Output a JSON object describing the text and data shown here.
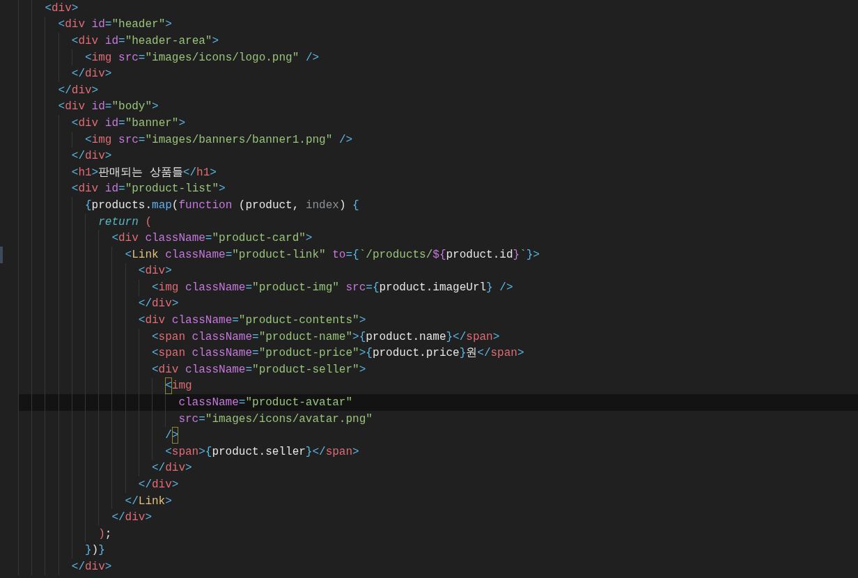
{
  "editor": {
    "lines": [
      {
        "current": false,
        "marked": false,
        "tokens": [
          {
            "kind": "punct",
            "text": "<"
          },
          {
            "kind": "tag",
            "text": "div"
          },
          {
            "kind": "punct",
            "text": ">"
          }
        ],
        "children": [
          {
            "current": false,
            "marked": false,
            "tokens": [
              {
                "kind": "punct",
                "text": "<"
              },
              {
                "kind": "tag",
                "text": "div"
              },
              {
                "kind": "attr",
                "text": " id"
              },
              {
                "kind": "punct",
                "text": "="
              },
              {
                "kind": "string",
                "text": "\"header\""
              },
              {
                "kind": "punct",
                "text": ">"
              }
            ],
            "children": [
              {
                "current": false,
                "marked": false,
                "tokens": [
                  {
                    "kind": "punct",
                    "text": "<"
                  },
                  {
                    "kind": "tag",
                    "text": "div"
                  },
                  {
                    "kind": "attr",
                    "text": " id"
                  },
                  {
                    "kind": "punct",
                    "text": "="
                  },
                  {
                    "kind": "string",
                    "text": "\"header-area\""
                  },
                  {
                    "kind": "punct",
                    "text": ">"
                  }
                ],
                "children": [
                  {
                    "current": false,
                    "marked": false,
                    "tokens": [
                      {
                        "kind": "punct",
                        "text": "<"
                      },
                      {
                        "kind": "tag",
                        "text": "img"
                      },
                      {
                        "kind": "attr",
                        "text": " src"
                      },
                      {
                        "kind": "punct",
                        "text": "="
                      },
                      {
                        "kind": "string",
                        "text": "\"images/icons/logo.png\""
                      },
                      {
                        "kind": "punct",
                        "text": " />"
                      }
                    ]
                  }
                ]
              },
              {
                "current": false,
                "marked": false,
                "tokens": [
                  {
                    "kind": "punct",
                    "text": "</"
                  },
                  {
                    "kind": "tag",
                    "text": "div"
                  },
                  {
                    "kind": "punct",
                    "text": ">"
                  }
                ]
              }
            ]
          },
          {
            "current": false,
            "marked": false,
            "tokens": [
              {
                "kind": "punct",
                "text": "</"
              },
              {
                "kind": "tag",
                "text": "div"
              },
              {
                "kind": "punct",
                "text": ">"
              }
            ]
          },
          {
            "current": false,
            "marked": false,
            "tokens": [
              {
                "kind": "punct",
                "text": "<"
              },
              {
                "kind": "tag",
                "text": "div"
              },
              {
                "kind": "attr",
                "text": " id"
              },
              {
                "kind": "punct",
                "text": "="
              },
              {
                "kind": "string",
                "text": "\"body\""
              },
              {
                "kind": "punct",
                "text": ">"
              }
            ],
            "children": [
              {
                "current": false,
                "marked": false,
                "tokens": [
                  {
                    "kind": "punct",
                    "text": "<"
                  },
                  {
                    "kind": "tag",
                    "text": "div"
                  },
                  {
                    "kind": "attr",
                    "text": " id"
                  },
                  {
                    "kind": "punct",
                    "text": "="
                  },
                  {
                    "kind": "string",
                    "text": "\"banner\""
                  },
                  {
                    "kind": "punct",
                    "text": ">"
                  }
                ],
                "children": [
                  {
                    "current": false,
                    "marked": false,
                    "tokens": [
                      {
                        "kind": "punct",
                        "text": "<"
                      },
                      {
                        "kind": "tag",
                        "text": "img"
                      },
                      {
                        "kind": "attr",
                        "text": " src"
                      },
                      {
                        "kind": "punct",
                        "text": "="
                      },
                      {
                        "kind": "string",
                        "text": "\"images/banners/banner1.png\""
                      },
                      {
                        "kind": "punct",
                        "text": " />"
                      }
                    ]
                  }
                ]
              },
              {
                "current": false,
                "marked": false,
                "tokens": [
                  {
                    "kind": "punct",
                    "text": "</"
                  },
                  {
                    "kind": "tag",
                    "text": "div"
                  },
                  {
                    "kind": "punct",
                    "text": ">"
                  }
                ]
              },
              {
                "current": false,
                "marked": false,
                "tokens": [
                  {
                    "kind": "punct",
                    "text": "<"
                  },
                  {
                    "kind": "tag",
                    "text": "h1"
                  },
                  {
                    "kind": "punct",
                    "text": ">"
                  },
                  {
                    "kind": "plain",
                    "text": "판매되는 상품들"
                  },
                  {
                    "kind": "punct",
                    "text": "</"
                  },
                  {
                    "kind": "tag",
                    "text": "h1"
                  },
                  {
                    "kind": "punct",
                    "text": ">"
                  }
                ]
              },
              {
                "current": false,
                "marked": false,
                "tokens": [
                  {
                    "kind": "punct",
                    "text": "<"
                  },
                  {
                    "kind": "tag",
                    "text": "div"
                  },
                  {
                    "kind": "attr",
                    "text": " id"
                  },
                  {
                    "kind": "punct",
                    "text": "="
                  },
                  {
                    "kind": "string",
                    "text": "\"product-list\""
                  },
                  {
                    "kind": "punct",
                    "text": ">"
                  }
                ],
                "children": [
                  {
                    "current": false,
                    "marked": false,
                    "tokens": [
                      {
                        "kind": "punct",
                        "text": "{"
                      },
                      {
                        "kind": "plain",
                        "text": "products."
                      },
                      {
                        "kind": "func",
                        "text": "map"
                      },
                      {
                        "kind": "plain",
                        "text": "("
                      },
                      {
                        "kind": "keyword",
                        "text": "function"
                      },
                      {
                        "kind": "plain",
                        "text": " (product, "
                      },
                      {
                        "kind": "param",
                        "text": "index"
                      },
                      {
                        "kind": "plain",
                        "text": ") "
                      },
                      {
                        "kind": "punct",
                        "text": "{"
                      }
                    ],
                    "children": [
                      {
                        "current": false,
                        "marked": false,
                        "tokens": [
                          {
                            "kind": "italic",
                            "text": "return"
                          },
                          {
                            "kind": "paren",
                            "text": " ("
                          }
                        ],
                        "children": [
                          {
                            "current": false,
                            "marked": false,
                            "tokens": [
                              {
                                "kind": "punct",
                                "text": "<"
                              },
                              {
                                "kind": "tag",
                                "text": "div"
                              },
                              {
                                "kind": "attr",
                                "text": " className"
                              },
                              {
                                "kind": "punct",
                                "text": "="
                              },
                              {
                                "kind": "string",
                                "text": "\"product-card\""
                              },
                              {
                                "kind": "punct",
                                "text": ">"
                              }
                            ],
                            "children": [
                              {
                                "current": false,
                                "marked": true,
                                "tokens": [
                                  {
                                    "kind": "punct",
                                    "text": "<"
                                  },
                                  {
                                    "kind": "component",
                                    "text": "Link"
                                  },
                                  {
                                    "kind": "attr",
                                    "text": " className"
                                  },
                                  {
                                    "kind": "punct",
                                    "text": "="
                                  },
                                  {
                                    "kind": "string",
                                    "text": "\"product-link\""
                                  },
                                  {
                                    "kind": "attr",
                                    "text": " to"
                                  },
                                  {
                                    "kind": "punct",
                                    "text": "={"
                                  },
                                  {
                                    "kind": "string",
                                    "text": "`/products/"
                                  },
                                  {
                                    "kind": "attr",
                                    "text": "${"
                                  },
                                  {
                                    "kind": "plain",
                                    "text": "product.id"
                                  },
                                  {
                                    "kind": "attr",
                                    "text": "}"
                                  },
                                  {
                                    "kind": "string",
                                    "text": "`"
                                  },
                                  {
                                    "kind": "punct",
                                    "text": "}>"
                                  }
                                ],
                                "children": [
                                  {
                                    "current": false,
                                    "marked": false,
                                    "tokens": [
                                      {
                                        "kind": "punct",
                                        "text": "<"
                                      },
                                      {
                                        "kind": "tag",
                                        "text": "div"
                                      },
                                      {
                                        "kind": "punct",
                                        "text": ">"
                                      }
                                    ],
                                    "children": [
                                      {
                                        "current": false,
                                        "marked": false,
                                        "tokens": [
                                          {
                                            "kind": "punct",
                                            "text": "<"
                                          },
                                          {
                                            "kind": "tag",
                                            "text": "img"
                                          },
                                          {
                                            "kind": "attr",
                                            "text": " className"
                                          },
                                          {
                                            "kind": "punct",
                                            "text": "="
                                          },
                                          {
                                            "kind": "string",
                                            "text": "\"product-img\""
                                          },
                                          {
                                            "kind": "attr",
                                            "text": " src"
                                          },
                                          {
                                            "kind": "punct",
                                            "text": "={"
                                          },
                                          {
                                            "kind": "plain",
                                            "text": "product.imageUrl"
                                          },
                                          {
                                            "kind": "punct",
                                            "text": "} />"
                                          }
                                        ]
                                      }
                                    ]
                                  },
                                  {
                                    "current": false,
                                    "marked": false,
                                    "tokens": [
                                      {
                                        "kind": "punct",
                                        "text": "</"
                                      },
                                      {
                                        "kind": "tag",
                                        "text": "div"
                                      },
                                      {
                                        "kind": "punct",
                                        "text": ">"
                                      }
                                    ]
                                  },
                                  {
                                    "current": false,
                                    "marked": false,
                                    "tokens": [
                                      {
                                        "kind": "punct",
                                        "text": "<"
                                      },
                                      {
                                        "kind": "tag",
                                        "text": "div"
                                      },
                                      {
                                        "kind": "attr",
                                        "text": " className"
                                      },
                                      {
                                        "kind": "punct",
                                        "text": "="
                                      },
                                      {
                                        "kind": "string",
                                        "text": "\"product-contents\""
                                      },
                                      {
                                        "kind": "punct",
                                        "text": ">"
                                      }
                                    ],
                                    "children": [
                                      {
                                        "current": false,
                                        "marked": false,
                                        "tokens": [
                                          {
                                            "kind": "punct",
                                            "text": "<"
                                          },
                                          {
                                            "kind": "tag",
                                            "text": "span"
                                          },
                                          {
                                            "kind": "attr",
                                            "text": " className"
                                          },
                                          {
                                            "kind": "punct",
                                            "text": "="
                                          },
                                          {
                                            "kind": "string",
                                            "text": "\"product-name\""
                                          },
                                          {
                                            "kind": "punct",
                                            "text": ">{"
                                          },
                                          {
                                            "kind": "plain",
                                            "text": "product.name"
                                          },
                                          {
                                            "kind": "punct",
                                            "text": "}</"
                                          },
                                          {
                                            "kind": "tag",
                                            "text": "span"
                                          },
                                          {
                                            "kind": "punct",
                                            "text": ">"
                                          }
                                        ]
                                      },
                                      {
                                        "current": false,
                                        "marked": false,
                                        "tokens": [
                                          {
                                            "kind": "punct",
                                            "text": "<"
                                          },
                                          {
                                            "kind": "tag",
                                            "text": "span"
                                          },
                                          {
                                            "kind": "attr",
                                            "text": " className"
                                          },
                                          {
                                            "kind": "punct",
                                            "text": "="
                                          },
                                          {
                                            "kind": "string",
                                            "text": "\"product-price\""
                                          },
                                          {
                                            "kind": "punct",
                                            "text": ">{"
                                          },
                                          {
                                            "kind": "plain",
                                            "text": "product.price"
                                          },
                                          {
                                            "kind": "punct",
                                            "text": "}"
                                          },
                                          {
                                            "kind": "plain",
                                            "text": "원"
                                          },
                                          {
                                            "kind": "punct",
                                            "text": "</"
                                          },
                                          {
                                            "kind": "tag",
                                            "text": "span"
                                          },
                                          {
                                            "kind": "punct",
                                            "text": ">"
                                          }
                                        ]
                                      },
                                      {
                                        "current": false,
                                        "marked": false,
                                        "tokens": [
                                          {
                                            "kind": "punct",
                                            "text": "<"
                                          },
                                          {
                                            "kind": "tag",
                                            "text": "div"
                                          },
                                          {
                                            "kind": "attr",
                                            "text": " className"
                                          },
                                          {
                                            "kind": "punct",
                                            "text": "="
                                          },
                                          {
                                            "kind": "string",
                                            "text": "\"product-seller\""
                                          },
                                          {
                                            "kind": "punct",
                                            "text": ">"
                                          }
                                        ],
                                        "children": [
                                          {
                                            "current": false,
                                            "marked": false,
                                            "tokens": [
                                              {
                                                "kind": "match",
                                                "text": "<"
                                              },
                                              {
                                                "kind": "tag",
                                                "text": "img"
                                              }
                                            ],
                                            "children": [
                                              {
                                                "current": true,
                                                "marked": false,
                                                "tokens": [
                                                  {
                                                    "kind": "attr",
                                                    "text": "className"
                                                  },
                                                  {
                                                    "kind": "punct",
                                                    "text": "="
                                                  },
                                                  {
                                                    "kind": "string",
                                                    "text": "\"product-avatar\""
                                                  }
                                                ]
                                              },
                                              {
                                                "current": false,
                                                "marked": false,
                                                "tokens": [
                                                  {
                                                    "kind": "attr",
                                                    "text": "src"
                                                  },
                                                  {
                                                    "kind": "punct",
                                                    "text": "="
                                                  },
                                                  {
                                                    "kind": "string",
                                                    "text": "\"images/icons/avatar.png\""
                                                  }
                                                ]
                                              }
                                            ]
                                          },
                                          {
                                            "current": false,
                                            "marked": false,
                                            "tokens": [
                                              {
                                                "kind": "punct",
                                                "text": "/"
                                              },
                                              {
                                                "kind": "match",
                                                "text": ">"
                                              }
                                            ]
                                          },
                                          {
                                            "current": false,
                                            "marked": false,
                                            "tokens": [
                                              {
                                                "kind": "punct",
                                                "text": "<"
                                              },
                                              {
                                                "kind": "tag",
                                                "text": "span"
                                              },
                                              {
                                                "kind": "punct",
                                                "text": ">{"
                                              },
                                              {
                                                "kind": "plain",
                                                "text": "product.seller"
                                              },
                                              {
                                                "kind": "punct",
                                                "text": "}</"
                                              },
                                              {
                                                "kind": "tag",
                                                "text": "span"
                                              },
                                              {
                                                "kind": "punct",
                                                "text": ">"
                                              }
                                            ]
                                          }
                                        ]
                                      },
                                      {
                                        "current": false,
                                        "marked": false,
                                        "tokens": [
                                          {
                                            "kind": "punct",
                                            "text": "</"
                                          },
                                          {
                                            "kind": "tag",
                                            "text": "div"
                                          },
                                          {
                                            "kind": "punct",
                                            "text": ">"
                                          }
                                        ]
                                      }
                                    ]
                                  },
                                  {
                                    "current": false,
                                    "marked": false,
                                    "tokens": [
                                      {
                                        "kind": "punct",
                                        "text": "</"
                                      },
                                      {
                                        "kind": "tag",
                                        "text": "div"
                                      },
                                      {
                                        "kind": "punct",
                                        "text": ">"
                                      }
                                    ]
                                  }
                                ]
                              },
                              {
                                "current": false,
                                "marked": false,
                                "tokens": [
                                  {
                                    "kind": "punct",
                                    "text": "</"
                                  },
                                  {
                                    "kind": "component",
                                    "text": "Link"
                                  },
                                  {
                                    "kind": "punct",
                                    "text": ">"
                                  }
                                ]
                              }
                            ]
                          },
                          {
                            "current": false,
                            "marked": false,
                            "tokens": [
                              {
                                "kind": "punct",
                                "text": "</"
                              },
                              {
                                "kind": "tag",
                                "text": "div"
                              },
                              {
                                "kind": "punct",
                                "text": ">"
                              }
                            ]
                          }
                        ]
                      },
                      {
                        "current": false,
                        "marked": false,
                        "tokens": [
                          {
                            "kind": "paren",
                            "text": ")"
                          },
                          {
                            "kind": "plain",
                            "text": ";"
                          }
                        ]
                      }
                    ]
                  },
                  {
                    "current": false,
                    "marked": false,
                    "tokens": [
                      {
                        "kind": "punct",
                        "text": "}"
                      },
                      {
                        "kind": "plain",
                        "text": ")"
                      },
                      {
                        "kind": "punct",
                        "text": "}"
                      }
                    ]
                  }
                ]
              },
              {
                "current": false,
                "marked": false,
                "tokens": [
                  {
                    "kind": "punct",
                    "text": "</"
                  },
                  {
                    "kind": "tag",
                    "text": "div"
                  },
                  {
                    "kind": "punct",
                    "text": ">"
                  }
                ]
              }
            ]
          }
        ]
      }
    ]
  }
}
